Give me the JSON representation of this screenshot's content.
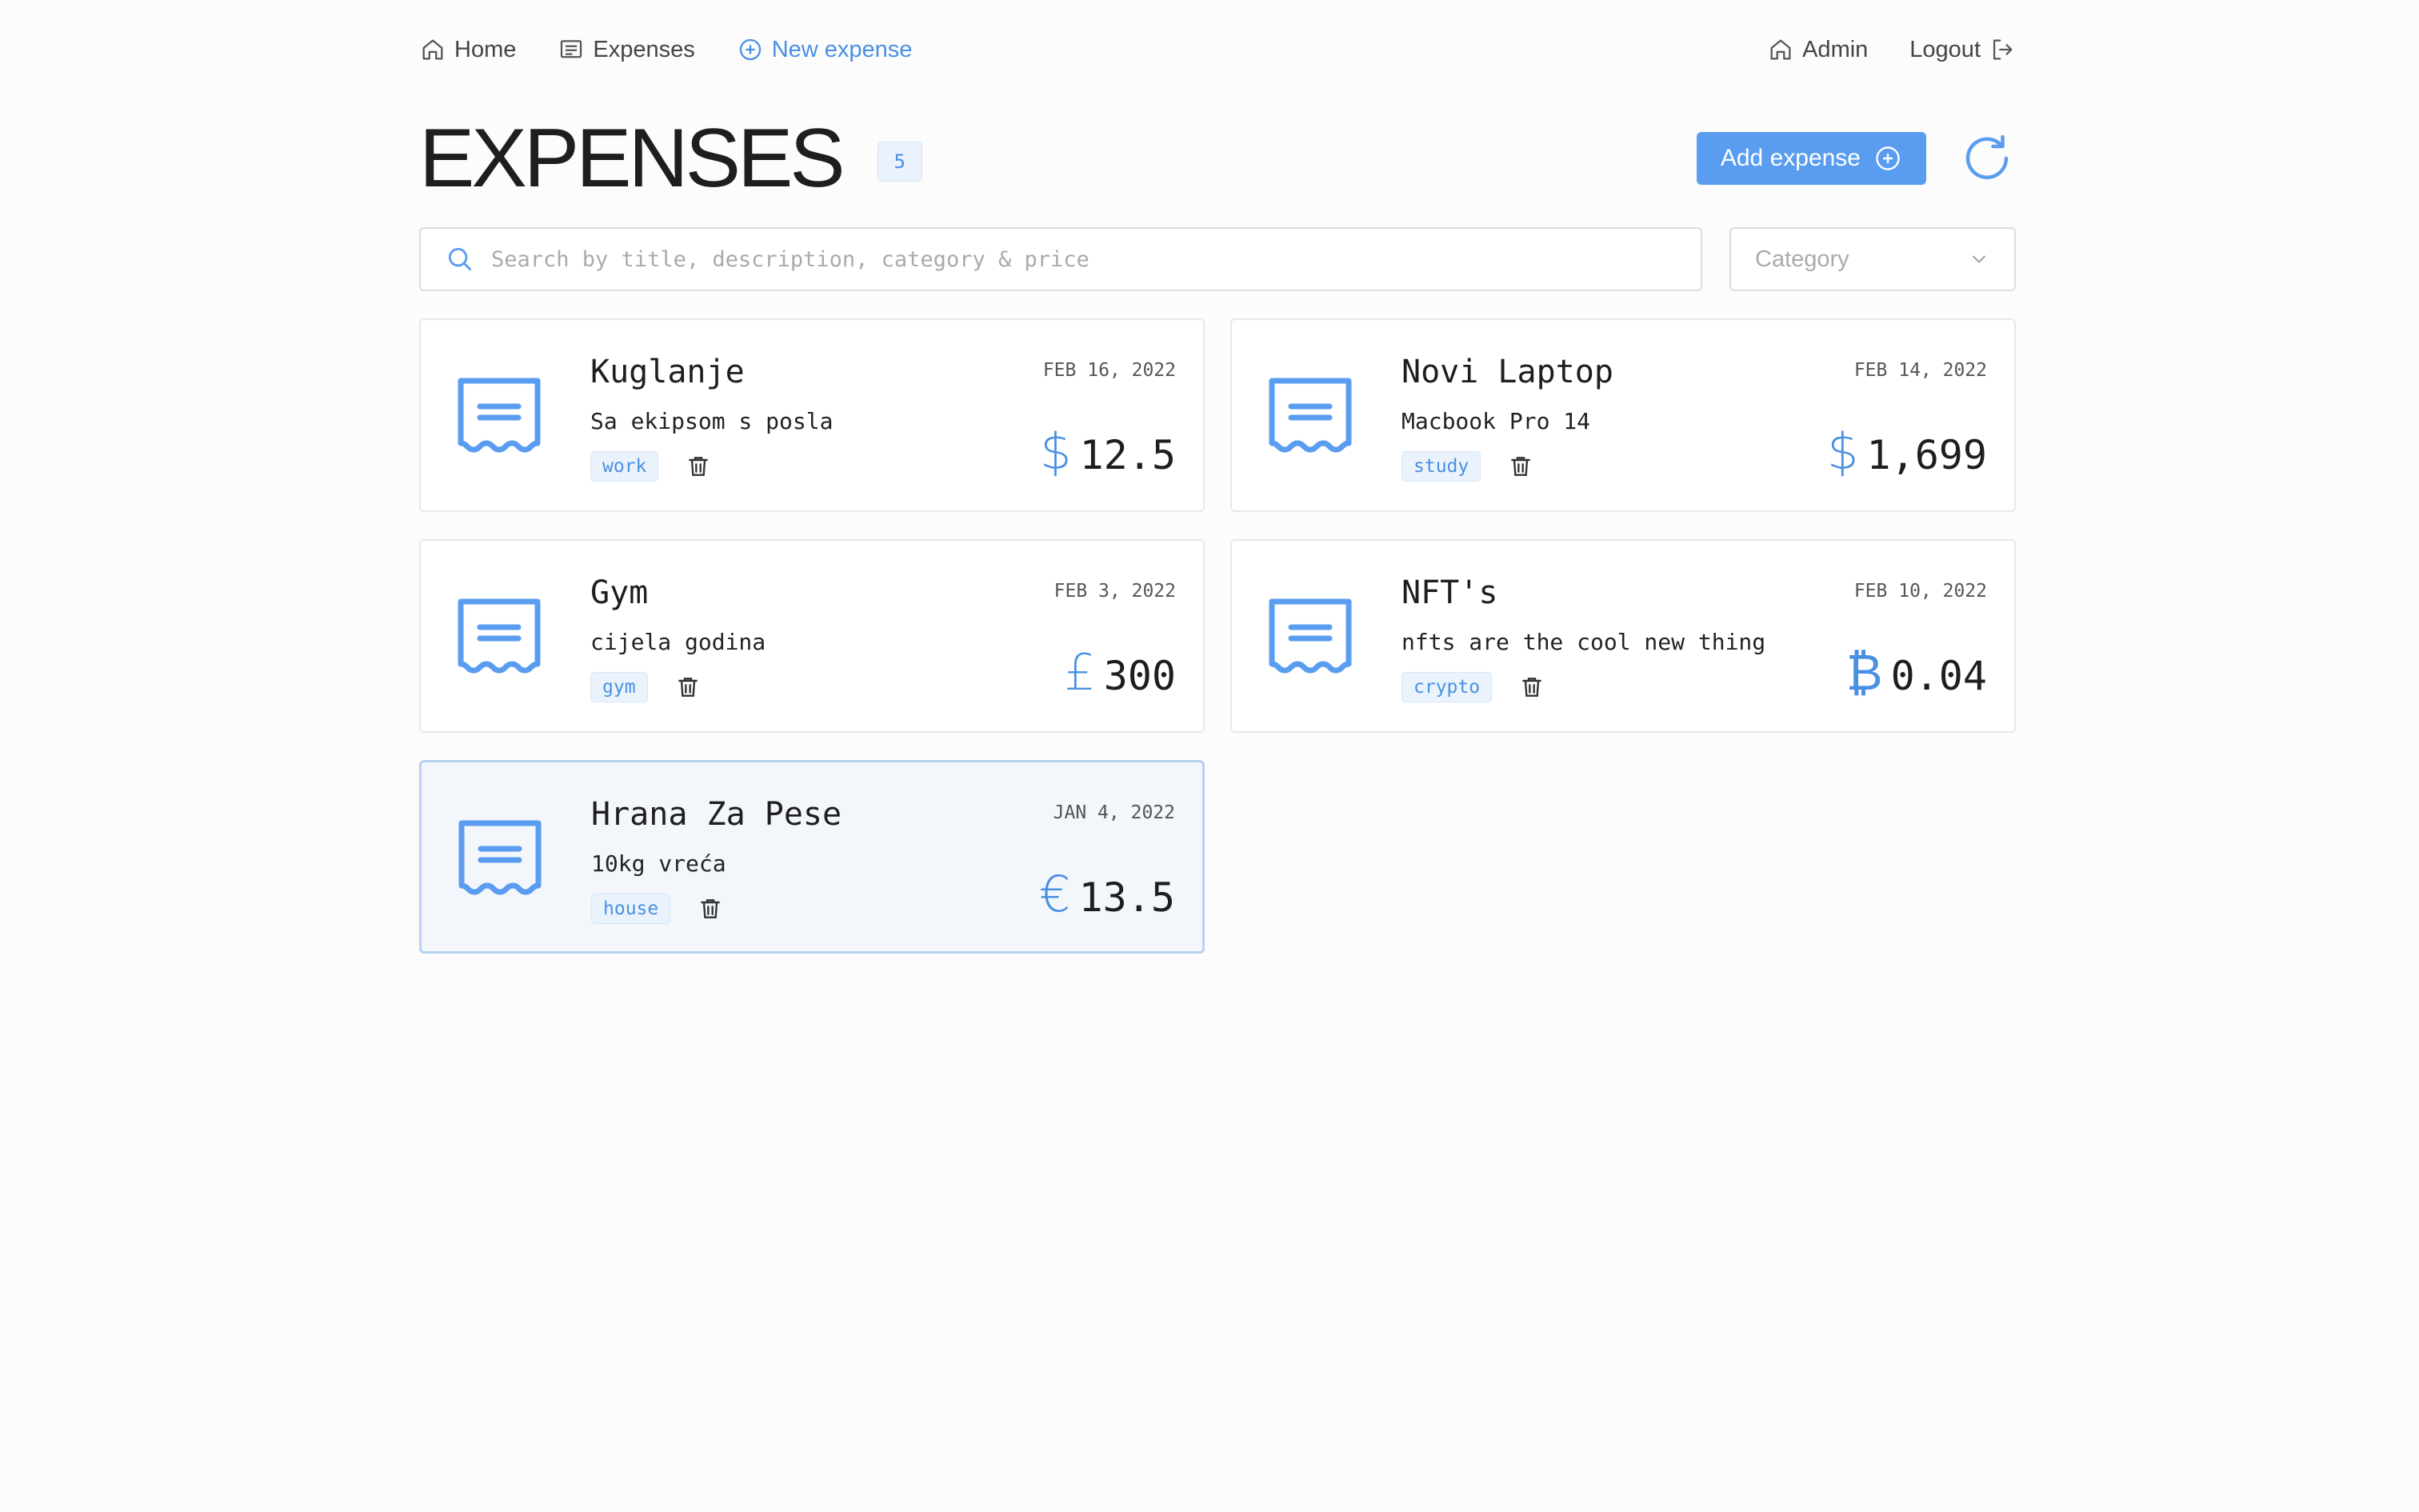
{
  "nav": {
    "home": "Home",
    "expenses": "Expenses",
    "new_expense": "New expense",
    "admin": "Admin",
    "logout": "Logout"
  },
  "header": {
    "title": "EXPENSES",
    "count": "5",
    "add_label": "Add expense"
  },
  "search": {
    "placeholder": "Search by title, description, category & price"
  },
  "category_select": {
    "placeholder": "Category"
  },
  "colors": {
    "accent": "#5a9df0",
    "selected_bg": "#f3f7fc",
    "tag_bg": "#eaf3fc"
  },
  "expenses": [
    {
      "title": "Kuglanje",
      "description": "Sa ekipsom s posla",
      "tag": "work",
      "date": "FEB 16, 2022",
      "currency": "$",
      "amount": "12.5",
      "selected": false
    },
    {
      "title": "Novi Laptop",
      "description": "Macbook Pro 14",
      "tag": "study",
      "date": "FEB 14, 2022",
      "currency": "$",
      "amount": "1,699",
      "selected": false
    },
    {
      "title": "Gym",
      "description": "cijela godina",
      "tag": "gym",
      "date": "FEB 3, 2022",
      "currency": "£",
      "amount": "300",
      "selected": false
    },
    {
      "title": "NFT's",
      "description": "nfts are the cool new thing",
      "tag": "crypto",
      "date": "FEB 10, 2022",
      "currency": "₿",
      "amount": "0.04",
      "selected": false
    },
    {
      "title": "Hrana Za Pese",
      "description": "10kg vreća",
      "tag": "house",
      "date": "JAN 4, 2022",
      "currency": "€",
      "amount": "13.5",
      "selected": true
    }
  ]
}
